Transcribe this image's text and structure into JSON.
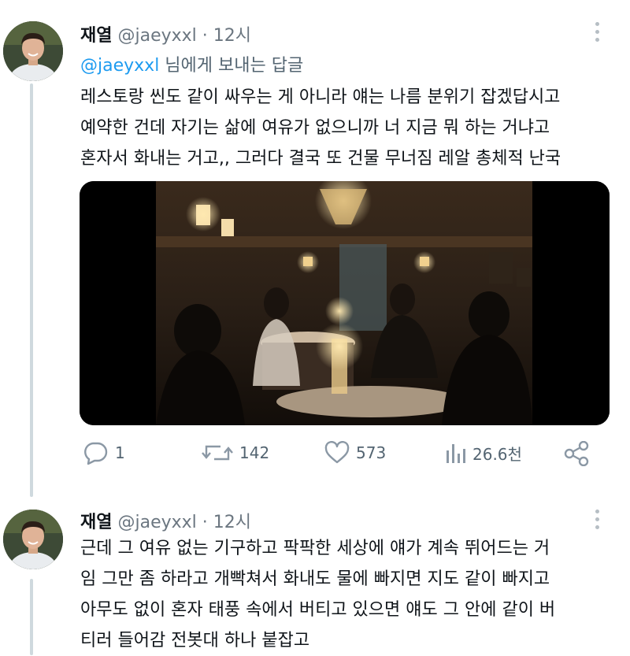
{
  "tweets": [
    {
      "name": "재열",
      "handle": "@jaeyxxl",
      "separator": "·",
      "time": "12시",
      "reply_prefix": "@jaeyxxl",
      "reply_suffix": " 님에게 보내는 답글",
      "lines": [
        "레스토랑 씬도 같이 싸우는 게 아니라 얘는 나름 분위기 잡겠답시고",
        "예약한 건데 자기는 삶에 여유가 없으니까 너 지금 뭐 하는 거냐고",
        "혼자서 화내는 거고,, 그러다 결국 또 건물 무너짐 레알 총체적 난국"
      ],
      "actions": {
        "reply_count": "1",
        "retweet_count": "142",
        "like_count": "573",
        "view_count": "26.6천"
      }
    },
    {
      "name": "재열",
      "handle": "@jaeyxxl",
      "separator": "·",
      "time": "12시",
      "lines": [
        "근데 그 여유 없는 기구하고 팍팍한 세상에 얘가 계속 뛰어드는 거",
        "임 그만 좀 하라고 개빡쳐서 화내도 물에 빠지면 지도 같이 빠지고",
        "아무도 없이 혼자 태풍 속에서 버티고 있으면 얘도 그 안에 같이 버",
        "티러 들어감 전봇대 하나 붙잡고"
      ]
    }
  ],
  "icons": {
    "reply": "reply-icon",
    "retweet": "retweet-icon",
    "like": "heart-icon",
    "views": "views-icon",
    "share": "share-icon",
    "more": "more-icon"
  },
  "colors": {
    "text": "#0f1419",
    "secondary": "#536471",
    "link": "#1d9bf0",
    "thread_line": "#cfd9de",
    "icon_gray": "#8b98a5"
  }
}
